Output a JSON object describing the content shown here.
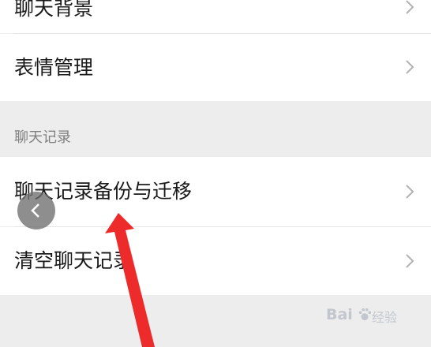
{
  "rows": {
    "chat_background": "聊天背景",
    "emoji_management": "表情管理",
    "backup_migrate": "聊天记录备份与迁移",
    "clear_history": "清空聊天记录"
  },
  "section": {
    "chat_history_header": "聊天记录"
  },
  "watermark": {
    "brand": "Bai",
    "suffix": "经验"
  },
  "colors": {
    "arrow": "#ee2b2b",
    "background": "#ededed",
    "row": "#ffffff"
  }
}
